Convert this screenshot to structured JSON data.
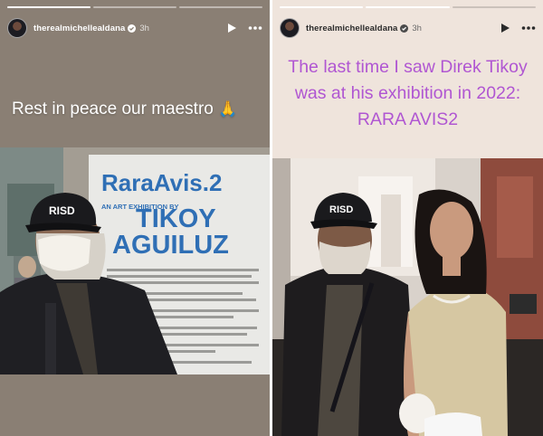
{
  "left_story": {
    "username": "therealmichellealdana",
    "time": "3h",
    "caption": "Rest in peace our maestro",
    "caption_emoji": "🙏",
    "photo": {
      "banner_title": "RaraAvis.2",
      "banner_subtitle": "AN ART EXHIBITION BY",
      "banner_artist_line1": "TIKOY",
      "banner_artist_line2": "AGUILUZ",
      "cap_text": "RISD"
    }
  },
  "right_story": {
    "username": "therealmichellealdana",
    "time": "3h",
    "caption_lines": [
      "The last time I saw Direk Tikoy",
      "was at his exhibition in 2022:",
      "RARA AVIS2"
    ],
    "photo": {
      "cap_text": "RISD"
    }
  },
  "icons": {
    "verified": "verified-badge-icon",
    "play": "play-icon",
    "more": "more-options-icon"
  },
  "colors": {
    "caption_right": "#b056d2",
    "caption_left": "#ffffff",
    "banner_blue": "#2f6fb5"
  }
}
